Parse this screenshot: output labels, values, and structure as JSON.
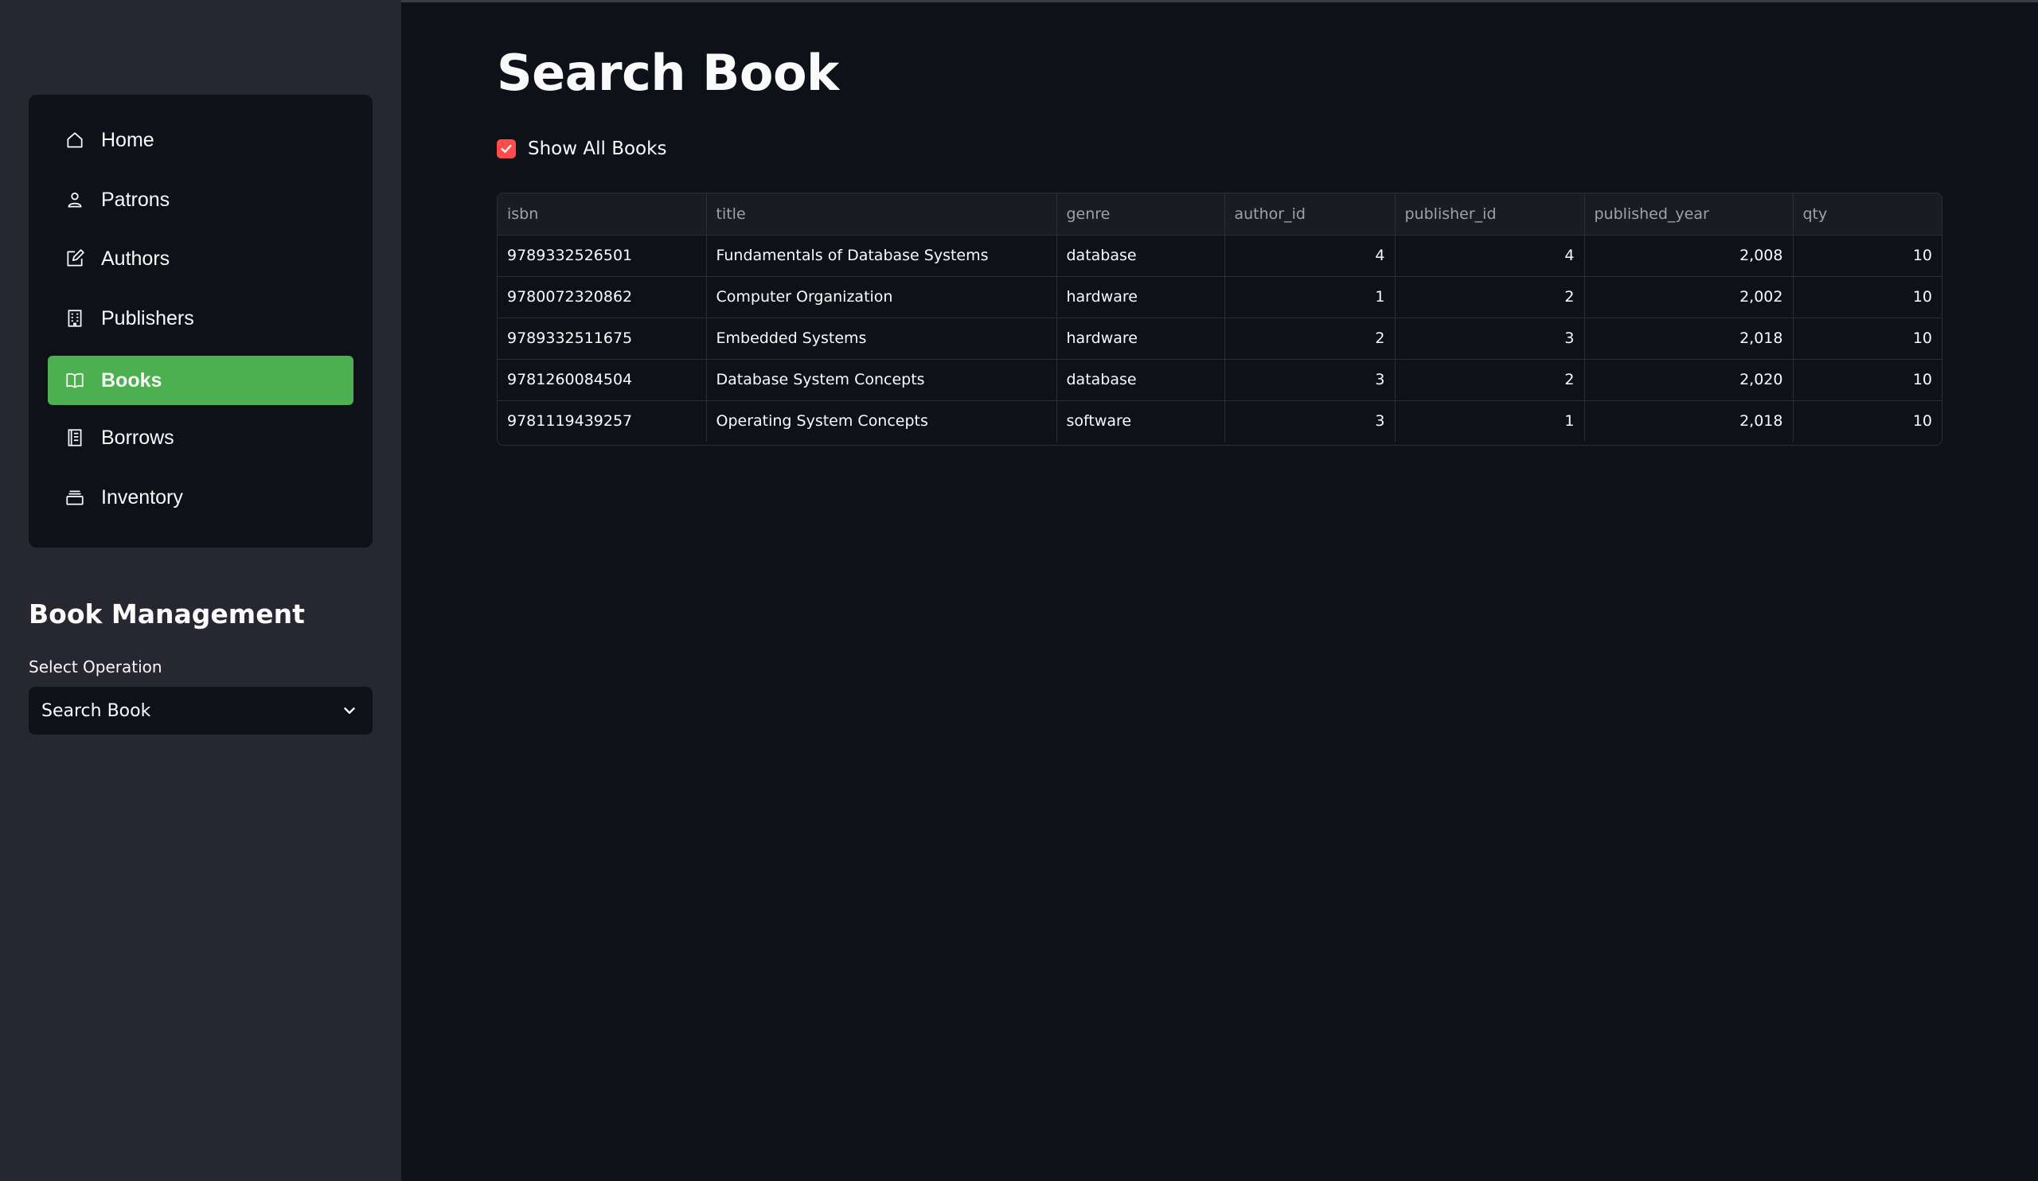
{
  "sidebar": {
    "nav": [
      {
        "label": "Home",
        "icon": "home-icon",
        "active": false
      },
      {
        "label": "Patrons",
        "icon": "person-icon",
        "active": false
      },
      {
        "label": "Authors",
        "icon": "edit-icon",
        "active": false
      },
      {
        "label": "Publishers",
        "icon": "building-icon",
        "active": false
      },
      {
        "label": "Books",
        "icon": "book-icon",
        "active": true
      },
      {
        "label": "Borrows",
        "icon": "journal-icon",
        "active": false
      },
      {
        "label": "Inventory",
        "icon": "archive-icon",
        "active": false
      }
    ],
    "section_title": "Book Management",
    "select_label": "Select Operation",
    "select_value": "Search Book"
  },
  "main": {
    "title": "Search Book",
    "checkbox_label": "Show All Books",
    "checkbox_checked": true,
    "table": {
      "columns": [
        "isbn",
        "title",
        "genre",
        "author_id",
        "publisher_id",
        "published_year",
        "qty"
      ],
      "rows": [
        [
          "9789332526501",
          "Fundamentals of Database Systems",
          "database",
          "4",
          "4",
          "2,008",
          "10"
        ],
        [
          "9780072320862",
          "Computer Organization",
          "hardware",
          "1",
          "2",
          "2,002",
          "10"
        ],
        [
          "9789332511675",
          "Embedded Systems",
          "hardware",
          "2",
          "3",
          "2,018",
          "10"
        ],
        [
          "9781260084504",
          "Database System Concepts",
          "database",
          "3",
          "2",
          "2,020",
          "10"
        ],
        [
          "9781119439257",
          "Operating System Concepts",
          "software",
          "3",
          "1",
          "2,018",
          "10"
        ]
      ]
    }
  },
  "colors": {
    "active_nav": "#4caf50",
    "checkbox": "#ff4b4b",
    "background": "#0e1117",
    "sidebar": "#262730"
  }
}
